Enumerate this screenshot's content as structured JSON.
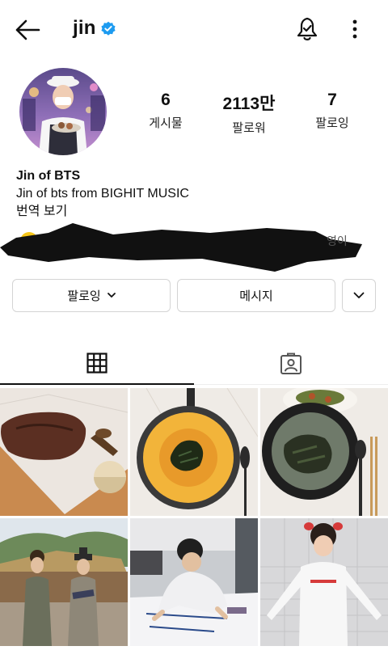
{
  "header": {
    "username": "jin",
    "icons": {
      "back": "arrow-left-icon",
      "verified": "verified-badge-icon",
      "notifications": "bell-check-icon",
      "menu": "more-vertical-icon"
    }
  },
  "profile": {
    "posts_count": "6",
    "posts_label": "게시물",
    "followers_count": "2113만",
    "followers_label": "팔로워",
    "following_count": "7",
    "following_label": "팔로잉",
    "display_name": "Jin of BTS",
    "bio": "Jin of bts from BIGHIT MUSIC",
    "translate_link": "번역 보기",
    "redacted_tail": "영이"
  },
  "actions": {
    "following_button": "팔로잉",
    "message_button": "메시지",
    "suggest_icon": "chevron-down-icon"
  },
  "tabs": [
    {
      "name": "grid",
      "icon": "grid-icon",
      "selected": true
    },
    {
      "name": "tagged",
      "icon": "tagged-person-icon",
      "selected": false
    }
  ],
  "colors": {
    "verified_blue": "#1d9bf0",
    "text": "#111111",
    "border": "#d4d4d4"
  },
  "posts": [
    {
      "subject": "grilled meat on wooden board"
    },
    {
      "subject": "rice dish in frying pan"
    },
    {
      "subject": "seaweed soup in black bowl"
    },
    {
      "subject": "two men in traditional hanbok at folk village"
    },
    {
      "subject": "man writing on large paper"
    },
    {
      "subject": "man in white long sleeve shirt with hair bows"
    }
  ]
}
